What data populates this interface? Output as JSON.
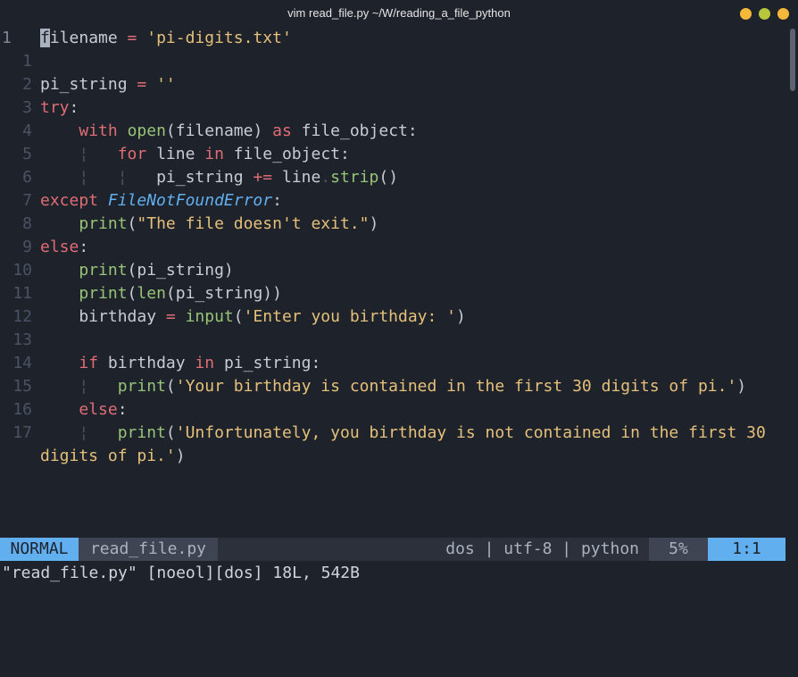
{
  "window": {
    "title": "vim read_file.py  ~/W/reading_a_file_python"
  },
  "lines": [
    {
      "num": "1",
      "current": true,
      "tokens": [
        [
          "cursor",
          "f"
        ],
        [
          "default",
          "ilename "
        ],
        [
          "operator",
          "="
        ],
        [
          "default",
          " "
        ],
        [
          "string",
          "'pi-digits.txt'"
        ]
      ]
    },
    {
      "num": "1",
      "tokens": []
    },
    {
      "num": "2",
      "tokens": [
        [
          "default",
          "pi_string "
        ],
        [
          "operator",
          "="
        ],
        [
          "default",
          " "
        ],
        [
          "string",
          "''"
        ]
      ]
    },
    {
      "num": "3",
      "tokens": [
        [
          "keyword",
          "try"
        ],
        [
          "default",
          ":"
        ]
      ]
    },
    {
      "num": "4",
      "tokens": [
        [
          "default",
          "    "
        ],
        [
          "keyword",
          "with"
        ],
        [
          "default",
          " "
        ],
        [
          "builtin",
          "open"
        ],
        [
          "default",
          "(filename) "
        ],
        [
          "keyword",
          "as"
        ],
        [
          "default",
          " file_object:"
        ]
      ]
    },
    {
      "num": "5",
      "tokens": [
        [
          "default",
          "    "
        ],
        [
          "guide",
          "¦"
        ],
        [
          "default",
          "   "
        ],
        [
          "keyword",
          "for"
        ],
        [
          "default",
          " line "
        ],
        [
          "keyword",
          "in"
        ],
        [
          "default",
          " file_object:"
        ]
      ]
    },
    {
      "num": "6",
      "tokens": [
        [
          "default",
          "    "
        ],
        [
          "guide",
          "¦"
        ],
        [
          "default",
          "   "
        ],
        [
          "guide",
          "¦"
        ],
        [
          "default",
          "   pi_string "
        ],
        [
          "operator",
          "+="
        ],
        [
          "default",
          " line"
        ],
        [
          "dot",
          "."
        ],
        [
          "builtin",
          "strip"
        ],
        [
          "default",
          "()"
        ]
      ]
    },
    {
      "num": "7",
      "tokens": [
        [
          "keyword",
          "except"
        ],
        [
          "default",
          " "
        ],
        [
          "exception",
          "FileNotFoundError"
        ],
        [
          "default",
          ":"
        ]
      ]
    },
    {
      "num": "8",
      "tokens": [
        [
          "default",
          "    "
        ],
        [
          "builtin",
          "print"
        ],
        [
          "default",
          "("
        ],
        [
          "string",
          "\"The file doesn't exit.\""
        ],
        [
          "default",
          ")"
        ]
      ]
    },
    {
      "num": "9",
      "tokens": [
        [
          "keyword",
          "else"
        ],
        [
          "default",
          ":"
        ]
      ]
    },
    {
      "num": "10",
      "tokens": [
        [
          "default",
          "    "
        ],
        [
          "builtin",
          "print"
        ],
        [
          "default",
          "(pi_string)"
        ]
      ]
    },
    {
      "num": "11",
      "tokens": [
        [
          "default",
          "    "
        ],
        [
          "builtin",
          "print"
        ],
        [
          "default",
          "("
        ],
        [
          "builtin",
          "len"
        ],
        [
          "default",
          "(pi_string))"
        ]
      ]
    },
    {
      "num": "12",
      "tokens": [
        [
          "default",
          "    birthday "
        ],
        [
          "operator",
          "="
        ],
        [
          "default",
          " "
        ],
        [
          "builtin",
          "input"
        ],
        [
          "default",
          "("
        ],
        [
          "string",
          "'Enter you birthday: '"
        ],
        [
          "default",
          ")"
        ]
      ]
    },
    {
      "num": "13",
      "tokens": []
    },
    {
      "num": "14",
      "tokens": [
        [
          "default",
          "    "
        ],
        [
          "keyword",
          "if"
        ],
        [
          "default",
          " birthday "
        ],
        [
          "keyword",
          "in"
        ],
        [
          "default",
          " pi_string:"
        ]
      ]
    },
    {
      "num": "15",
      "tokens": [
        [
          "default",
          "    "
        ],
        [
          "guide",
          "¦"
        ],
        [
          "default",
          "   "
        ],
        [
          "builtin",
          "print"
        ],
        [
          "default",
          "("
        ],
        [
          "string",
          "'Your birthday is contained in the first 30 digits of pi.'"
        ],
        [
          "default",
          ")"
        ]
      ]
    },
    {
      "num": "16",
      "tokens": [
        [
          "default",
          "    "
        ],
        [
          "keyword",
          "else"
        ],
        [
          "default",
          ":"
        ]
      ]
    },
    {
      "num": "17",
      "tokens": [
        [
          "default",
          "    "
        ],
        [
          "guide",
          "¦"
        ],
        [
          "default",
          "   "
        ],
        [
          "builtin",
          "print"
        ],
        [
          "default",
          "("
        ],
        [
          "string",
          "'Unfortunately, you birthday is not contained in the first 30"
        ]
      ]
    },
    {
      "num": "",
      "tokens": [
        [
          "string",
          "digits of pi.'"
        ],
        [
          "default",
          ")"
        ]
      ]
    }
  ],
  "statusline": {
    "mode": "NORMAL",
    "filename": "read_file.py",
    "info": "dos | utf-8 | python",
    "percent": "5%",
    "position": "1:1"
  },
  "cmdline": "\"read_file.py\" [noeol][dos] 18L, 542B",
  "colors": {
    "background": "#1e222a",
    "keyword": "#e06c75",
    "string": "#e5c07b",
    "builtin": "#98c379",
    "exception": "#61afef",
    "accent": "#61afef"
  }
}
